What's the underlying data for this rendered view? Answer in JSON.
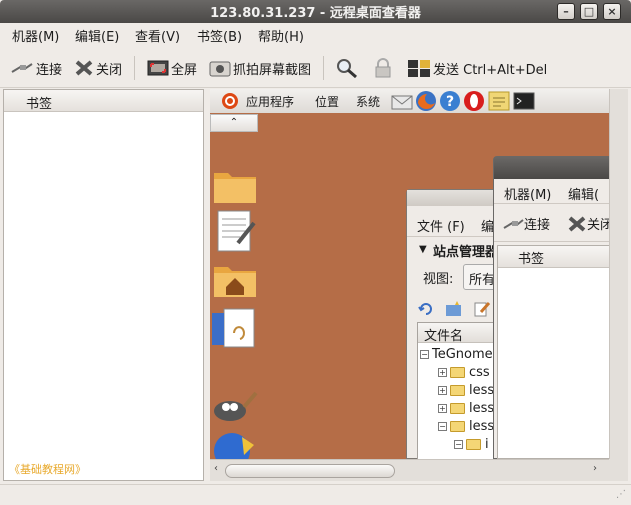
{
  "window": {
    "title": "123.80.31.237 - 远程桌面查看器"
  },
  "menubar": [
    "机器(M)",
    "编辑(E)",
    "查看(V)",
    "书签(B)",
    "帮助(H)"
  ],
  "toolbar": {
    "connect": "连接",
    "close": "关闭",
    "fullscreen": "全屏",
    "screenshot": "抓拍屏幕截图",
    "send_keys": "发送 Ctrl+Alt+Del"
  },
  "sidebar": {
    "header": "书签",
    "footnote": "《基础教程网》"
  },
  "remote_panel": {
    "applications": "应用程序",
    "places": "位置",
    "system": "系统",
    "collapse": "⌃"
  },
  "nested_site_manager": {
    "menu_file": "文件 (F)",
    "menu_edit": "编",
    "title": "站点管理器",
    "view_label": "视图:",
    "view_value": "所有",
    "column_filename": "文件名",
    "tree": [
      "TeGnome",
      "css",
      "less",
      "less",
      "less",
      "i"
    ]
  },
  "nested_viewer": {
    "menu_machine": "机器(M)",
    "menu_edit": "编辑(",
    "connect": "连接",
    "close": "关闭",
    "bookmarks": "书签"
  }
}
